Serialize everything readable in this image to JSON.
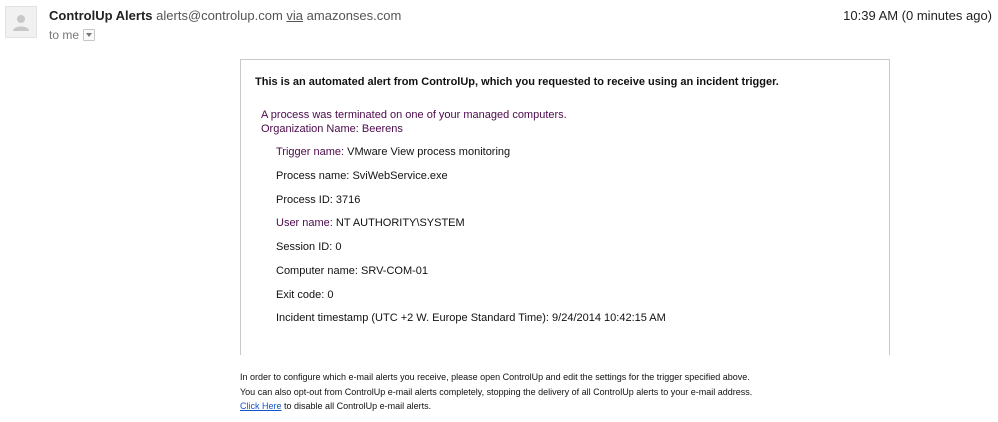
{
  "header": {
    "sender_name": "ControlUp Alerts",
    "sender_email": "alerts@controlup.com",
    "via_label": "via",
    "via_domain": "amazonses.com",
    "to_label": "to me",
    "time": "10:39 AM (0 minutes ago)"
  },
  "alert": {
    "header": "This is an automated alert from ControlUp, which you requested to receive using an incident trigger.",
    "intro_line1": "A process was terminated on one of your managed computers.",
    "intro_line2": "Organization Name: Beerens",
    "fields": [
      {
        "label": "Trigger name:",
        "value": "VMware View process monitoring"
      },
      {
        "label": "Process name:",
        "value": "SviWebService.exe"
      },
      {
        "label": "Process ID:",
        "value": "3716"
      },
      {
        "label": "User name:",
        "value": "NT AUTHORITY\\SYSTEM"
      },
      {
        "label": "Session ID:",
        "value": "0"
      },
      {
        "label": "Computer name:",
        "value": "SRV-COM-01"
      },
      {
        "label": "Exit code:",
        "value": "0"
      },
      {
        "label": "Incident timestamp (UTC +2 W. Europe Standard Time):",
        "value": "9/24/2014 10:42:15 AM"
      }
    ]
  },
  "footer": {
    "line1": "In order to configure which e-mail alerts you receive, please open ControlUp and edit the settings for the trigger specified above.",
    "line2": "You can also opt-out from ControlUp e-mail alerts completely, stopping the delivery of all ControlUp alerts to your e-mail address.",
    "link": "Click Here",
    "line3_rest": "to disable all ControlUp e-mail alerts."
  },
  "colors": {
    "purple_text": "#4b0a4b",
    "link": "#1155cc"
  }
}
